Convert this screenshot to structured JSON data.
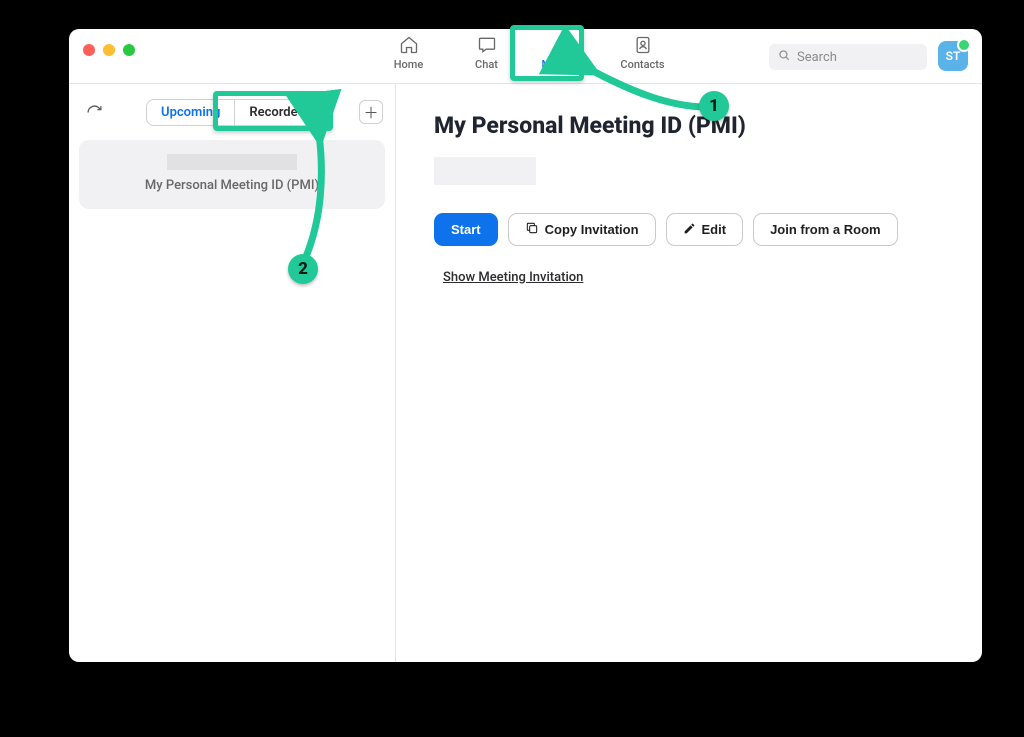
{
  "nav": {
    "home": "Home",
    "chat": "Chat",
    "meetings": "Meetings",
    "contacts": "Contacts"
  },
  "search": {
    "placeholder": "Search"
  },
  "avatar": {
    "initials": "ST"
  },
  "sidebar": {
    "segments": {
      "upcoming": "Upcoming",
      "recorded": "Recorded"
    },
    "card_label": "My Personal Meeting ID (PMI)"
  },
  "main": {
    "title": "My Personal Meeting ID (PMI)",
    "buttons": {
      "start": "Start",
      "copy": "Copy Invitation",
      "edit": "Edit",
      "join_room": "Join from a Room"
    },
    "show_invitation": "Show Meeting Invitation"
  },
  "annotations": {
    "one": "1",
    "two": "2"
  }
}
